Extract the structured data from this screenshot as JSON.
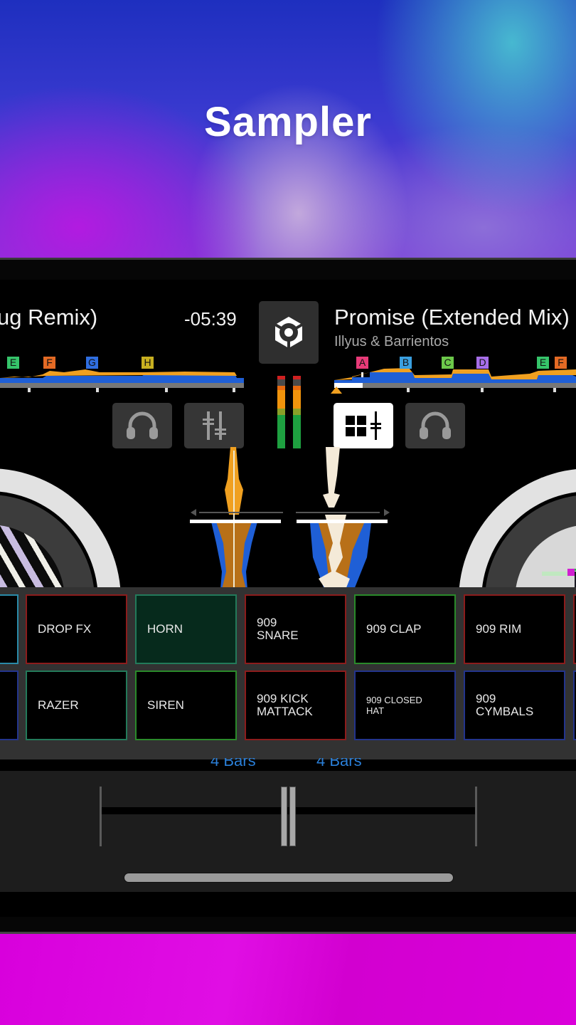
{
  "headline": "Sampler",
  "colors": {
    "waveform_blue": "#1f5fd6",
    "waveform_orange": "#f0a020",
    "accent_blue": "#2a7fd8",
    "pad_border_red": "#8c1c1c",
    "pad_border_green": "#2a8a2a",
    "pad_border_teal": "#237a5a",
    "pad_border_blue": "#23348c",
    "pad_border_cyan": "#2a8aa8",
    "horn_fill": "#062a1c"
  },
  "deck_left": {
    "title": "ug Remix)",
    "time_remaining": "-05:39",
    "cue_points": [
      {
        "label": "E",
        "color": "#35c46a"
      },
      {
        "label": "F",
        "color": "#e46a24"
      },
      {
        "label": "G",
        "color": "#2f6ee0"
      },
      {
        "label": "H",
        "color": "#c8b020"
      }
    ]
  },
  "deck_right": {
    "title": "Promise (Extended Mix)",
    "artist": "Illyus & Barrientos",
    "cue_points": [
      {
        "label": "A",
        "color": "#e83a78"
      },
      {
        "label": "B",
        "color": "#3aa0e0"
      },
      {
        "label": "C",
        "color": "#6cc84a"
      },
      {
        "label": "D",
        "color": "#a66ee8"
      },
      {
        "label": "E",
        "color": "#35c46a"
      },
      {
        "label": "F",
        "color": "#e46a24"
      }
    ]
  },
  "center": {
    "logo_icon": "app-logo-icon"
  },
  "buttons": {
    "left_headphones": "headphones-icon",
    "mixer": "mixer-faders-icon",
    "sampler_toggle": "sampler-grid-icon",
    "right_headphones": "headphones-icon"
  },
  "sampler": {
    "row1": [
      {
        "label": "",
        "border": "#2a8aa8"
      },
      {
        "label": "DROP FX",
        "border": "#8c1c1c"
      },
      {
        "label": "HORN",
        "border": "#237a5a",
        "active": true
      },
      {
        "label": "909\nSNARE",
        "border": "#8c1c1c"
      },
      {
        "label": "909 CLAP",
        "border": "#2a8a2a"
      },
      {
        "label": "909 RIM",
        "border": "#8c1c1c"
      },
      {
        "label": "",
        "border": "#8c1c1c"
      }
    ],
    "row2": [
      {
        "label": "",
        "border": "#23348c"
      },
      {
        "label": "RAZER",
        "border": "#237a5a"
      },
      {
        "label": "SIREN",
        "border": "#2a8a2a"
      },
      {
        "label": "909 KICK\nMATTACK",
        "border": "#8c1c1c"
      },
      {
        "label": "909 CLOSED\nHAT",
        "border": "#23348c",
        "small": true
      },
      {
        "label": "909\nCYMBALS",
        "border": "#23348c"
      },
      {
        "label": "",
        "border": "#23348c"
      }
    ]
  },
  "loop": {
    "left_label": "4 Bars",
    "right_label": "4 Bars"
  },
  "crossfader": {
    "position_fraction": 0.5
  }
}
